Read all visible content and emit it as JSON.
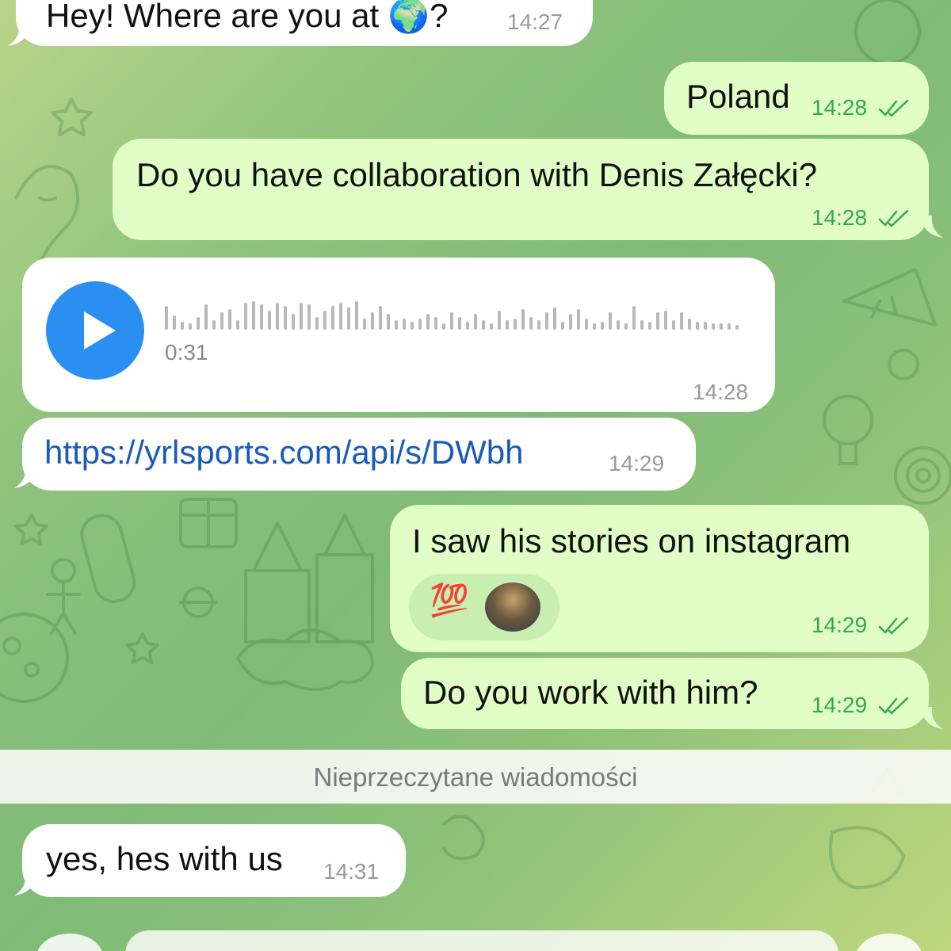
{
  "messages": [
    {
      "id": "m1",
      "side": "in",
      "text": "Hey! Where are you at 🌍?",
      "time": "14:27"
    },
    {
      "id": "m2",
      "side": "out",
      "text": "Poland",
      "time": "14:28",
      "status": "read"
    },
    {
      "id": "m3",
      "side": "out",
      "text": "Do you have collaboration with Denis Załęcki?",
      "time": "14:28",
      "status": "read"
    },
    {
      "id": "m4",
      "side": "in",
      "type": "voice",
      "duration": "0:31",
      "time": "14:28"
    },
    {
      "id": "m5",
      "side": "in",
      "text": "https://yrlsports.com/api/s/DWbh",
      "time": "14:29"
    },
    {
      "id": "m6",
      "side": "out",
      "text": "I saw his stories on instagram",
      "time": "14:29",
      "status": "read",
      "reactions": [
        "💯",
        "avatar"
      ]
    },
    {
      "id": "m7",
      "side": "out",
      "text": "Do you work with him?",
      "time": "14:29",
      "status": "read"
    },
    {
      "id": "m8",
      "side": "in",
      "text": "yes, hes with us",
      "time": "14:31"
    }
  ],
  "divider": {
    "label": "Nieprzeczytane wiadomości"
  },
  "colors": {
    "incoming": "#ffffff",
    "outgoing": "#e1fec6",
    "accent": "#2a8ff0",
    "time_out": "#32a852",
    "link": "#1a5bb8"
  },
  "icons": [
    "play-icon",
    "double-check-icon",
    "earth-emoji",
    "hundred-emoji",
    "sender-avatar"
  ]
}
